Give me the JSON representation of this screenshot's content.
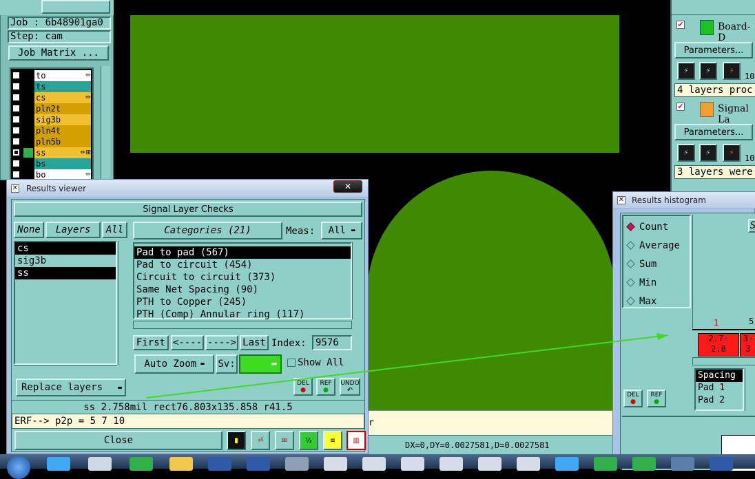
{
  "job_panel": {
    "job_label": "Job : 6b48901ga0",
    "step_label": "Step: cam",
    "job_matrix_button": "Job Matrix ...",
    "layers": [
      {
        "name": "to",
        "color": "#ffffff",
        "flag": "✏"
      },
      {
        "name": "ts",
        "color": "#2aa39a",
        "flag": ""
      },
      {
        "name": "cs",
        "color": "#f0c030",
        "flag": "✏"
      },
      {
        "name": "pln2t",
        "color": "#d4a000",
        "flag": ""
      },
      {
        "name": "sig3b",
        "color": "#f0c030",
        "flag": ""
      },
      {
        "name": "pln4t",
        "color": "#d4a000",
        "flag": ""
      },
      {
        "name": "pln5b",
        "color": "#d4a000",
        "flag": ""
      },
      {
        "name": "ss",
        "color": "#f0c030",
        "flag": "✏⊞"
      },
      {
        "name": "bs",
        "color": "#2aa39a",
        "flag": ""
      },
      {
        "name": "bo",
        "color": "#ffffff",
        "flag": "✏"
      }
    ]
  },
  "results_viewer": {
    "window_title": "Results viewer",
    "heading": "Signal Layer Checks",
    "none_button": "None",
    "layers_label": "Layers",
    "all_button": "All",
    "layer_list": [
      "cs",
      "sig3b",
      "ss"
    ],
    "categories_label": "Categories (21)",
    "meas_label": "Meas:",
    "meas_value": "All",
    "categories": [
      "Pad to pad (567)",
      "Pad to circuit (454)",
      "Circuit to circuit (373)",
      "Same Net Spacing (90)",
      "PTH to Copper (245)",
      "PTH (Comp) Annular ring (117)"
    ],
    "first_button": "First",
    "prev_button": "<----",
    "next_button": "---->",
    "last_button": "Last",
    "index_label": "Index:",
    "index_value": "9576",
    "auto_zoom_label": "Auto Zoom",
    "sv_label": "Sv:",
    "show_all_label": "Show All",
    "replace_layers_label": "Replace layers",
    "del_label": "DEL",
    "ref_label": "REF",
    "undo_label": "UNDO",
    "measure_line": "ss 2.758mil  rect76.803x135.858  r41.5",
    "erf_line": "ERF--> p2p = 5 7 10",
    "close_button": "Close"
  },
  "status": {
    "dx_readout": "DX=0,DY=0.0027581,D=0.0027581",
    "partial_char": "r"
  },
  "right_panel": {
    "board_item": "Board-D",
    "signal_item": "Signal La",
    "params_label_1": "Parameters...",
    "params_label_2": "Parameters...",
    "msg_1": "4 layers proc",
    "msg_2": "3 layers were",
    "count_1": "10",
    "count_2": "10"
  },
  "histogram": {
    "window_title": "Results histogram",
    "options": [
      "Count",
      "Average",
      "Sum",
      "Min",
      "Max"
    ],
    "selected": "Count",
    "s_label": "S",
    "bar_count_1": "1",
    "bar_count_2": "5",
    "bar_label_1": "2.7-\n2.8",
    "bar_label_2": "3-\n3",
    "list": [
      "Spacing",
      "Pad 1",
      "Pad 2"
    ],
    "del_label": "DEL",
    "ref_label": "REF"
  },
  "colors": {
    "board_green": "#3f8a00",
    "panel_teal": "#8fcfc8",
    "bar_red": "#ff1a1a"
  }
}
